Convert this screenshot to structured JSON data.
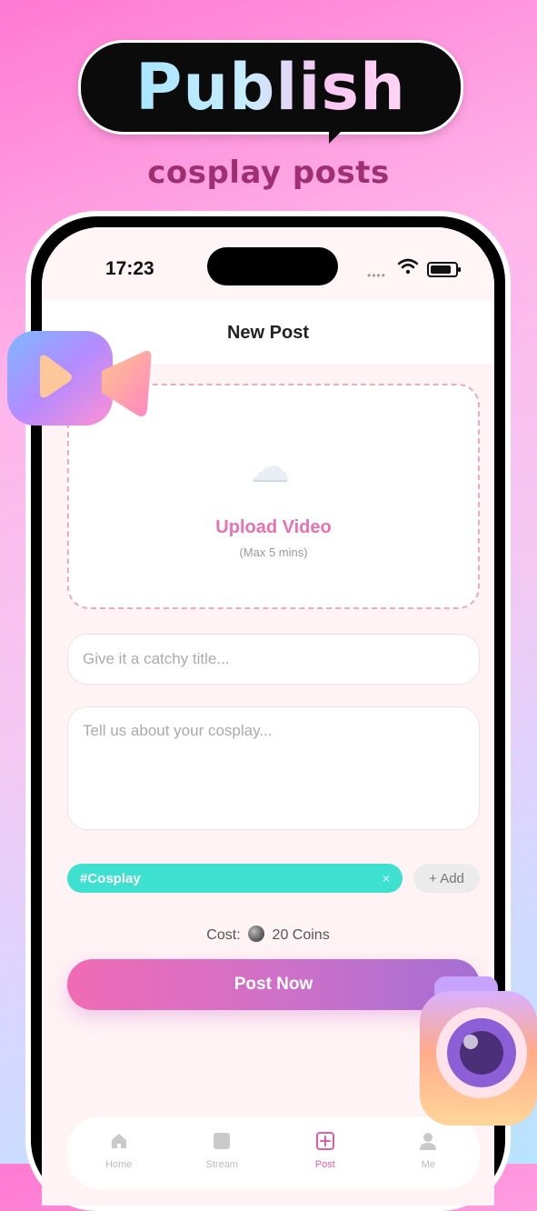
{
  "hero": {
    "title": "Publish",
    "subtitle": "cosplay posts"
  },
  "status_bar": {
    "time": "17:23"
  },
  "header": {
    "title": "New Post"
  },
  "upload": {
    "icon": "cloud-icon",
    "label": "Upload Video",
    "hint": "(Max 5 mins)"
  },
  "form": {
    "title_placeholder": "Give it a catchy title...",
    "description_placeholder": "Tell us about your cosplay..."
  },
  "tags": {
    "items": [
      {
        "label": "#Cosplay",
        "remove": "×"
      }
    ],
    "add_label": "+ Add"
  },
  "cost": {
    "prefix": "Cost:",
    "amount": "20 Coins"
  },
  "post_button": {
    "label": "Post Now"
  },
  "tab_bar": {
    "items": [
      {
        "label": "Home",
        "icon": "home-icon"
      },
      {
        "label": "Stream",
        "icon": "stream-icon"
      },
      {
        "label": "Post",
        "icon": "plus-square-icon",
        "active": true
      },
      {
        "label": "Me",
        "icon": "user-icon"
      }
    ]
  },
  "colors": {
    "accent": "#ec6fb1",
    "tag": "#3ee0cf",
    "button_start": "#f06bb4",
    "button_end": "#a56fd3"
  }
}
